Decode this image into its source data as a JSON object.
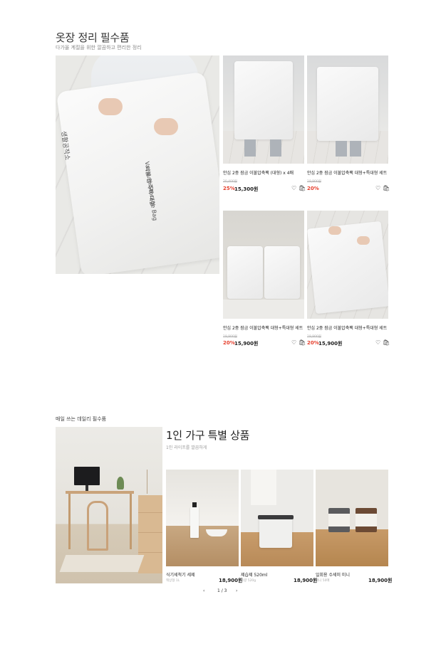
{
  "section1": {
    "title": "옷장 정리 필수품",
    "subtitle": "다가올 계절을 위한 깔끔하고 편리한 정리",
    "hero_image": {
      "text_a": "생활공작소",
      "text_b": "이불 압축팩 대형",
      "text_c": "Vacuum Storage Bag"
    },
    "products": [
      {
        "name": "안심 2중 잠금 이불압축팩 (대형) x 4매",
        "old_price": "20,400원",
        "discount": "25%",
        "price": "15,300원"
      },
      {
        "name": "안심 2중 잠금 이불압축팩 대형+특대형 세트",
        "old_price": "19,900원",
        "discount": "20%",
        "price": ""
      },
      {
        "name": "안심 2중 잠금 이불압축팩 대형+특대형 세트",
        "old_price": "19,900원",
        "discount": "20%",
        "price": "15,900원"
      },
      {
        "name": "안심 2중 잠금 이불압축팩 대형+특대형 세트",
        "old_price": "19,900원",
        "discount": "20%",
        "price": "15,900원"
      }
    ]
  },
  "section2": {
    "label": "매일 쓰는 데일리 필수품",
    "title": "1인 가구 특별 상품",
    "subtitle": "1인 라이프를 깔끔하게",
    "products": [
      {
        "name": "식기세척기 세제",
        "sub": "액상형 1L",
        "price": "18,900원"
      },
      {
        "name": "제습제 520ml",
        "sub": "용량 520g",
        "price": "18,900원"
      },
      {
        "name": "일회용 수세미 미니",
        "sub": "미니 50매",
        "price": "18,900원"
      }
    ],
    "pager": {
      "prev": "‹",
      "page": "1 / 3",
      "next": "›"
    }
  },
  "icons": {
    "wishlist": "heart-icon",
    "cart": "cart-icon"
  },
  "colors": {
    "discount": "#e6402e",
    "text": "#222222"
  }
}
